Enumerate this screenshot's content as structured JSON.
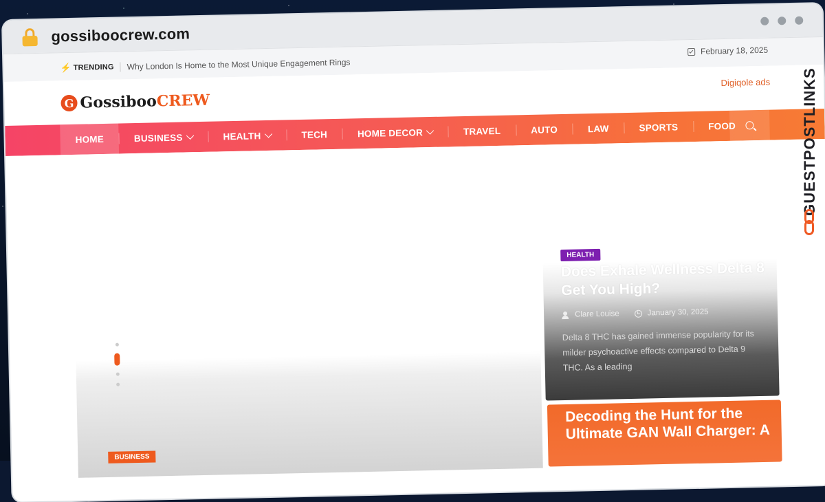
{
  "browser": {
    "url": "gossiboocrew.com"
  },
  "topbar": {
    "trending_label": "TRENDING",
    "trending_headline": "Why London Is Home to the Most Unique Engagement Rings",
    "date": "February 18, 2025"
  },
  "header": {
    "logo_part1": "Gossiboo",
    "logo_part2": "CREW",
    "logo_mark": "G",
    "ad_alt": "Digiqole ads"
  },
  "nav": {
    "items": [
      {
        "label": "HOME",
        "active": true
      },
      {
        "label": "BUSINESS",
        "dropdown": true
      },
      {
        "label": "HEALTH",
        "dropdown": true
      },
      {
        "label": "TECH"
      },
      {
        "label": "HOME DECOR",
        "dropdown": true
      },
      {
        "label": "TRAVEL"
      },
      {
        "label": "AUTO"
      },
      {
        "label": "LAW"
      },
      {
        "label": "SPORTS"
      },
      {
        "label": "FOOD"
      }
    ]
  },
  "featured": {
    "category": "BUSINESS"
  },
  "side_posts": [
    {
      "category": "HEALTH",
      "title": "Does Exhale Wellness Delta 8 Get You High?",
      "author": "Clare Louise",
      "date": "January 30, 2025",
      "excerpt": "Delta 8 THC has gained immense popularity for its milder psychoactive effects compared to Delta 9 THC. As a leading"
    },
    {
      "title": "Decoding the Hunt for the Ultimate GAN Wall Charger: A"
    }
  ],
  "watermark": "GUESTPOSTLINKS",
  "colors": {
    "accent": "#ee5a1e",
    "nav_start": "#f54466",
    "nav_end": "#f77b34",
    "health_badge": "#7d1fb0"
  }
}
